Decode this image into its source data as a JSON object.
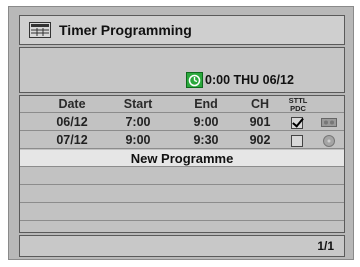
{
  "title": "Timer Programming",
  "clock": {
    "time": "0:00",
    "day": "THU",
    "date": "06/12",
    "text": "0:00 THU 06/12"
  },
  "table": {
    "headers": {
      "date": "Date",
      "start": "Start",
      "end": "End",
      "ch": "CH",
      "sttl_line1": "STTL",
      "sttl_line2": "PDC"
    },
    "rows": [
      {
        "date": "06/12",
        "start": "7:00",
        "end": "9:00",
        "ch": "901",
        "checked": true,
        "icon": "videotape-icon"
      },
      {
        "date": "07/12",
        "start": "9:00",
        "end": "9:30",
        "ch": "902",
        "checked": false,
        "icon": "disc-icon"
      }
    ],
    "new_programme": "New Programme"
  },
  "footer": {
    "page": "1/1"
  },
  "colors": {
    "clock_icon": "#2aa83c",
    "panel": "#c2c2c2",
    "highlight": "#e6e6e6"
  }
}
